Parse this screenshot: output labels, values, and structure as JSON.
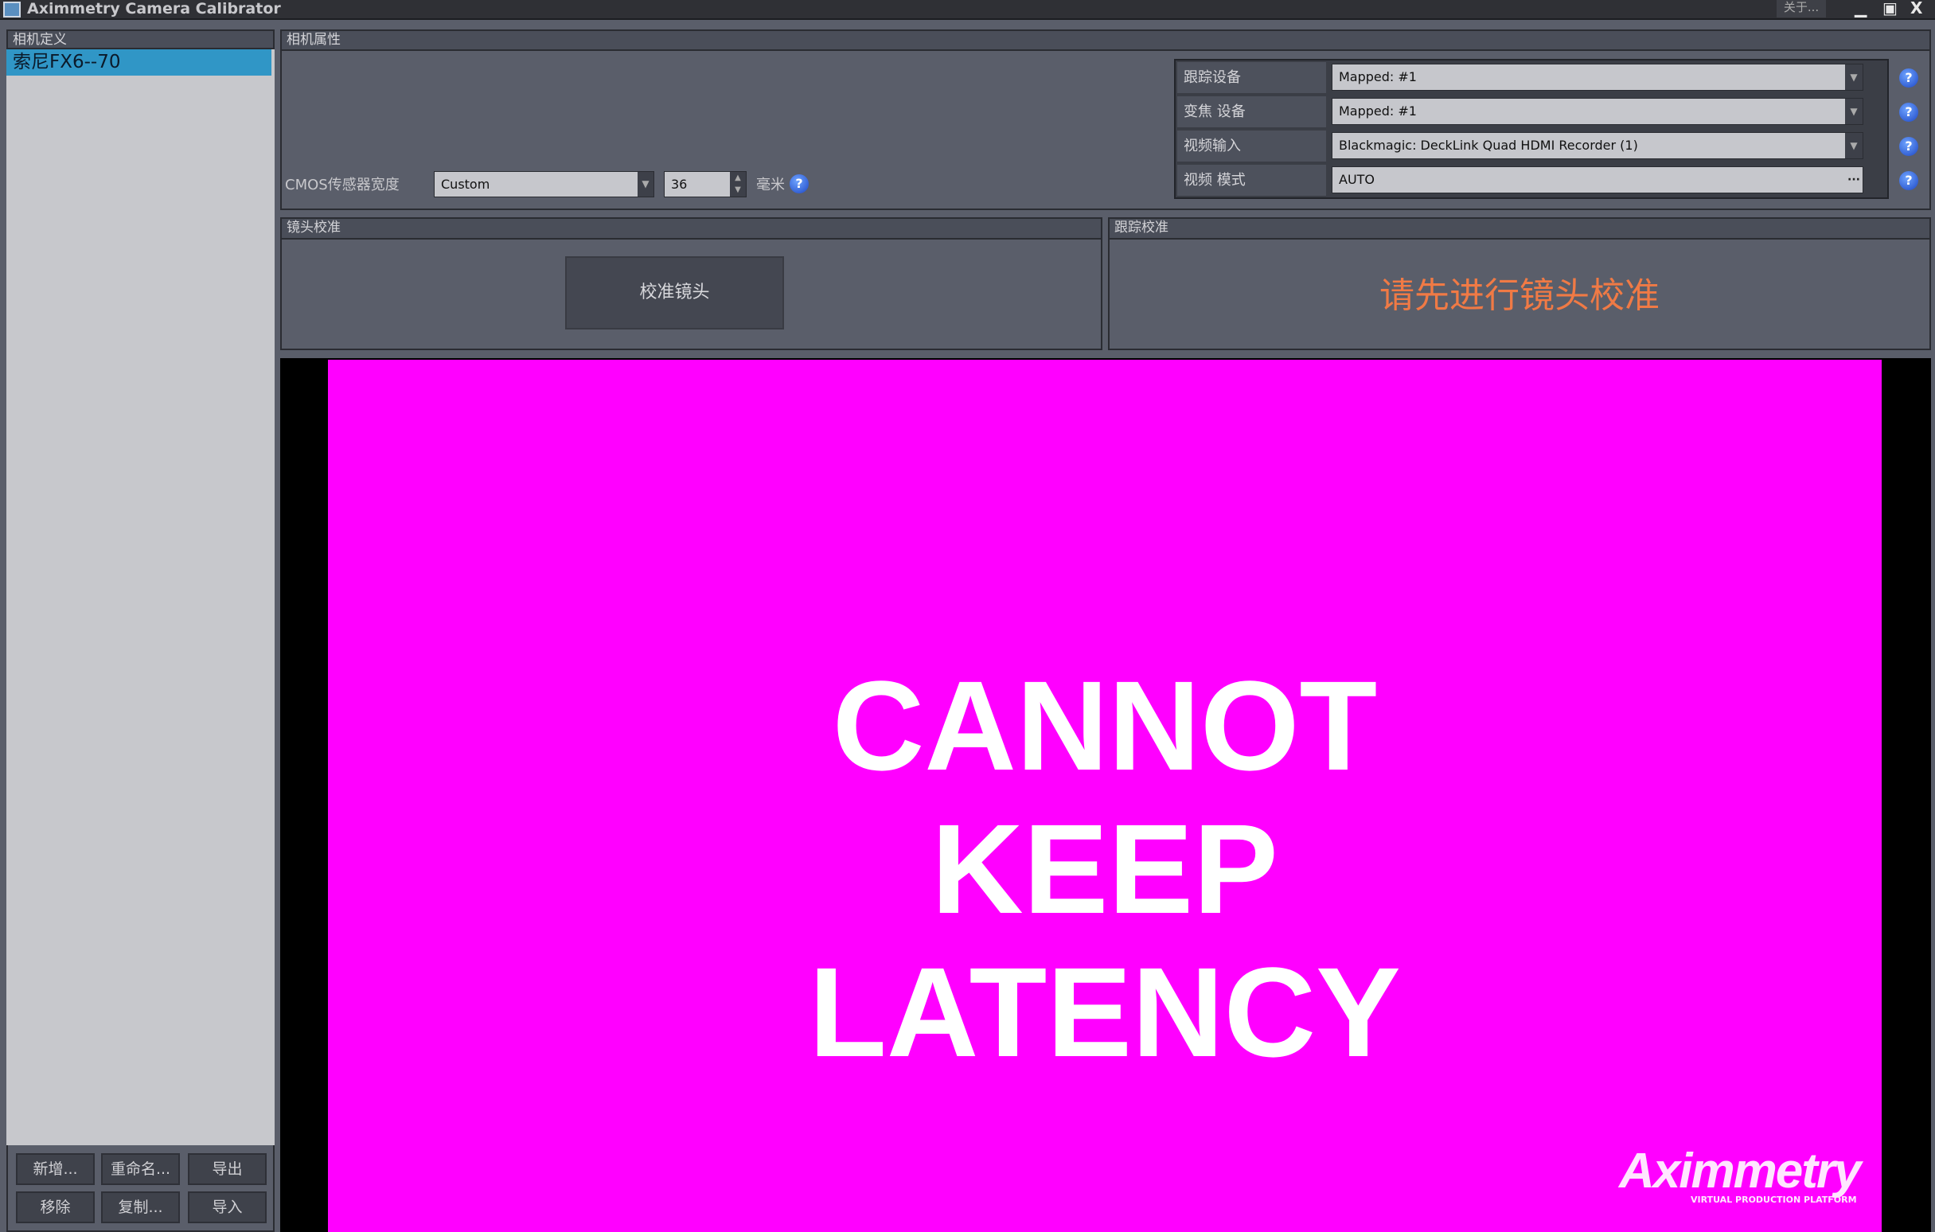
{
  "window": {
    "title": "Aximmetry Camera Calibrator",
    "about_label": "关于...",
    "minimize": "▁",
    "maximize": "▣",
    "close": "X"
  },
  "left_panel": {
    "header": "相机定义",
    "cameras": [
      {
        "name": "索尼FX6--70",
        "selected": true
      }
    ],
    "buttons": {
      "new": "新增...",
      "rename": "重命名...",
      "export": "导出",
      "remove": "移除",
      "copy": "复制...",
      "import": "导入"
    }
  },
  "camera_properties": {
    "header": "相机属性",
    "cmos_label": "CMOS传感器宽度",
    "cmos_preset": "Custom",
    "cmos_width": "36",
    "cmos_unit": "毫米",
    "rows": [
      {
        "label": "跟踪设备",
        "value": "Mapped: #1",
        "control": "dropdown"
      },
      {
        "label": "变焦 设备",
        "value": "Mapped: #1",
        "control": "dropdown"
      },
      {
        "label": "视频输入",
        "value": "Blackmagic: DeckLink Quad HDMI Recorder (1)",
        "control": "dropdown"
      },
      {
        "label": "视频 模式",
        "value": "AUTO",
        "control": "ellipsis"
      }
    ],
    "help": "?"
  },
  "lens_calibration": {
    "header": "镜头校准",
    "button": "校准镜头"
  },
  "tracking_calibration": {
    "header": "跟踪校准",
    "message": "请先进行镜头校准",
    "message_color": "#f07a45"
  },
  "preview": {
    "line1": "CANNOT KEEP",
    "line2": "LATENCY",
    "background": "#ff00ff",
    "logo": "Aximmetry",
    "logo_tagline": "VIRTUAL PRODUCTION PLATFORM"
  }
}
